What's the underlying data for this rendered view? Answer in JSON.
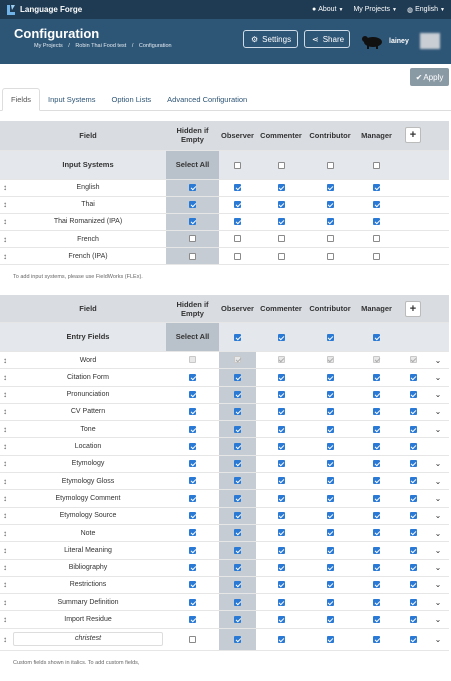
{
  "topbar": {
    "brand": "Language Forge",
    "about": "About",
    "my_projects": "My Projects",
    "language": "English"
  },
  "header": {
    "title": "Configuration",
    "breadcrumbs": [
      "My Projects",
      "/",
      "Robin Thai Food test",
      "/",
      "Configuration"
    ],
    "settings_label": "Settings",
    "share_label": "Share",
    "username": "lainey"
  },
  "apply_label": "Apply",
  "tabs": [
    "Fields",
    "Input Systems",
    "Option Lists",
    "Advanced Configuration"
  ],
  "columns": {
    "field": "Field",
    "hidden": "Hidden if Empty",
    "observer": "Observer",
    "commenter": "Commenter",
    "contributor": "Contributor",
    "manager": "Manager",
    "select_all": "Select All"
  },
  "input_systems": {
    "title": "Input Systems",
    "rows": [
      {
        "name": "English",
        "sel": true,
        "obs": true,
        "com": true,
        "con": true,
        "man": true
      },
      {
        "name": "Thai",
        "sel": true,
        "obs": true,
        "com": true,
        "con": true,
        "man": true
      },
      {
        "name": "Thai Romanized (IPA)",
        "sel": true,
        "obs": true,
        "com": true,
        "con": true,
        "man": true
      },
      {
        "name": "French",
        "sel": false,
        "obs": false,
        "com": false,
        "con": false,
        "man": false
      },
      {
        "name": "French (IPA)",
        "sel": false,
        "obs": false,
        "com": false,
        "con": false,
        "man": false
      }
    ],
    "note": "To add input systems, please use FieldWorks (FLEx)."
  },
  "entry_fields": {
    "title": "Entry Fields",
    "rows": [
      {
        "name": "Word",
        "hidden": false,
        "disabled": true,
        "chevron": true
      },
      {
        "name": "Citation Form",
        "hidden": true,
        "chevron": true
      },
      {
        "name": "Pronunciation",
        "hidden": true,
        "chevron": true
      },
      {
        "name": "CV Pattern",
        "hidden": true,
        "chevron": true
      },
      {
        "name": "Tone",
        "hidden": true,
        "chevron": true
      },
      {
        "name": "Location",
        "hidden": true,
        "chevron": false
      },
      {
        "name": "Etymology",
        "hidden": true,
        "chevron": true
      },
      {
        "name": "Etymology Gloss",
        "hidden": true,
        "chevron": true
      },
      {
        "name": "Etymology Comment",
        "hidden": true,
        "chevron": true
      },
      {
        "name": "Etymology Source",
        "hidden": true,
        "chevron": true
      },
      {
        "name": "Note",
        "hidden": true,
        "chevron": true
      },
      {
        "name": "Literal Meaning",
        "hidden": true,
        "chevron": true
      },
      {
        "name": "Bibliography",
        "hidden": true,
        "chevron": true
      },
      {
        "name": "Restrictions",
        "hidden": true,
        "chevron": true
      },
      {
        "name": "Summary Definition",
        "hidden": true,
        "chevron": true
      },
      {
        "name": "Import Residue",
        "hidden": true,
        "chevron": true
      },
      {
        "name": "christest",
        "hidden": false,
        "custom": true,
        "chevron": true
      }
    ],
    "note": "Custom fields shown in italics. To add custom fields,"
  },
  "colors": {
    "topbar": "#1f3b54",
    "header": "#2d5576",
    "checkbox": "#2a7ad5"
  }
}
